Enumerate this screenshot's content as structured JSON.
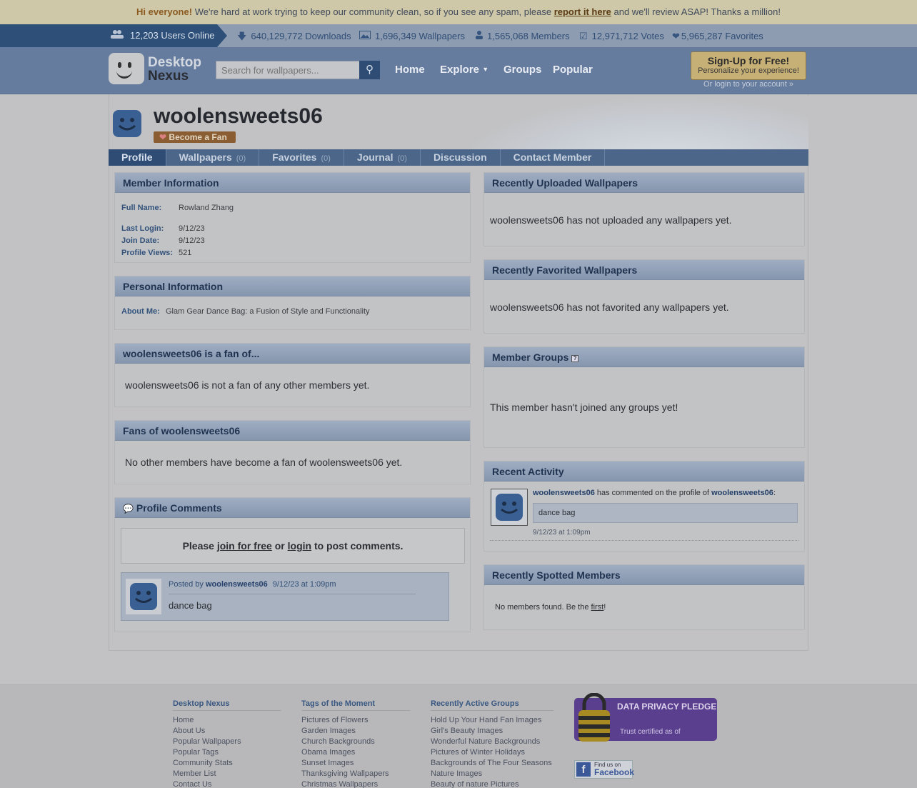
{
  "notice": {
    "hi": "Hi everyone!",
    "before": "We're hard at work trying to keep our community clean, so if you see any spam, please",
    "link": "report it here",
    "after": "and we'll review ASAP!  Thanks a million!"
  },
  "stats": {
    "online": "12,203 Users Online",
    "downloads": "640,129,772 Downloads",
    "wallpapers": "1,696,349 Wallpapers",
    "members": "1,565,068 Members",
    "votes": "12,971,712 Votes",
    "favorites": "5,965,287 Favorites"
  },
  "header": {
    "logo_line1": "Desktop",
    "logo_line2": "Nexus",
    "search_placeholder": "Search for wallpapers...",
    "nav": [
      "Home",
      "Explore",
      "Groups",
      "Popular"
    ],
    "signup_title": "Sign-Up for Free!",
    "signup_sub": "Personalize your experience!",
    "login_link": "Or login to your account »"
  },
  "profile": {
    "username": "woolensweets06",
    "fan_button": "Become a Fan",
    "tabs": [
      {
        "label": "Profile",
        "count": ""
      },
      {
        "label": "Wallpapers",
        "count": "(0)"
      },
      {
        "label": "Favorites",
        "count": "(0)"
      },
      {
        "label": "Journal",
        "count": "(0)"
      },
      {
        "label": "Discussion",
        "count": ""
      },
      {
        "label": "Contact Member",
        "count": ""
      }
    ]
  },
  "member_info": {
    "title": "Member Information",
    "full_name_label": "Full Name:",
    "full_name": "Rowland Zhang",
    "last_login_label": "Last Login:",
    "last_login": "9/12/23",
    "join_date_label": "Join Date:",
    "join_date": "9/12/23",
    "views_label": "Profile Views:",
    "views": "521"
  },
  "personal_info": {
    "title": "Personal Information",
    "about_label": "About Me:",
    "about": "Glam Gear Dance Bag: a Fusion of Style and Functionality"
  },
  "fan_of": {
    "title": "woolensweets06 is a fan of...",
    "message": "woolensweets06 is not a fan of any other members yet."
  },
  "fans": {
    "title": "Fans of woolensweets06",
    "message": "No other members have become a fan of woolensweets06 yet."
  },
  "comments": {
    "title": "Profile Comments",
    "prompt_before": "Please",
    "join_link": "join for free",
    "or": "or",
    "login_link": "login",
    "prompt_after": "to post comments.",
    "posted_by": "Posted by",
    "author": "woolensweets06",
    "time": "9/12/23 at 1:09pm",
    "text": "dance bag"
  },
  "uploaded": {
    "title": "Recently Uploaded Wallpapers",
    "message": "woolensweets06 has not uploaded any wallpapers yet."
  },
  "favorited": {
    "title": "Recently Favorited Wallpapers",
    "message": "woolensweets06 has not favorited any wallpapers yet."
  },
  "groups": {
    "title": "Member Groups",
    "help": "?",
    "message": "This member hasn't joined any groups yet!"
  },
  "activity": {
    "title": "Recent Activity",
    "user": "woolensweets06",
    "action": "has commented on the profile of",
    "target": "woolensweets06",
    "colon": ":",
    "quote": "dance bag",
    "time": "9/12/23 at 1:09pm"
  },
  "spotted": {
    "title": "Recently Spotted Members",
    "before": "No members found. Be the",
    "link": "first",
    "after": "!"
  },
  "footer": {
    "col1_title": "Desktop Nexus",
    "col1": [
      "Home",
      "About Us",
      "Popular Wallpapers",
      "Popular Tags",
      "Community Stats",
      "Member List",
      "Contact Us"
    ],
    "col2_title": "Tags of the Moment",
    "col2": [
      "Pictures of Flowers",
      "Garden Images",
      "Church Backgrounds",
      "Obama Images",
      "Sunset Images",
      "Thanksgiving Wallpapers",
      "Christmas Wallpapers"
    ],
    "col3_title": "Recently Active Groups",
    "col3": [
      "Hold Up Your Hand Fan Images",
      "Girl's Beauty Images",
      "Wonderful Nature Backgrounds",
      "Pictures of Winter Holidays",
      "Backgrounds of The Four Seasons",
      "Nature Images",
      "Beauty of nature Pictures"
    ],
    "pledge_title": "DATA PRIVACY PLEDGE",
    "pledge_sub": "Trust certified as of",
    "fb_small": "Find us on",
    "fb_big": "Facebook"
  }
}
